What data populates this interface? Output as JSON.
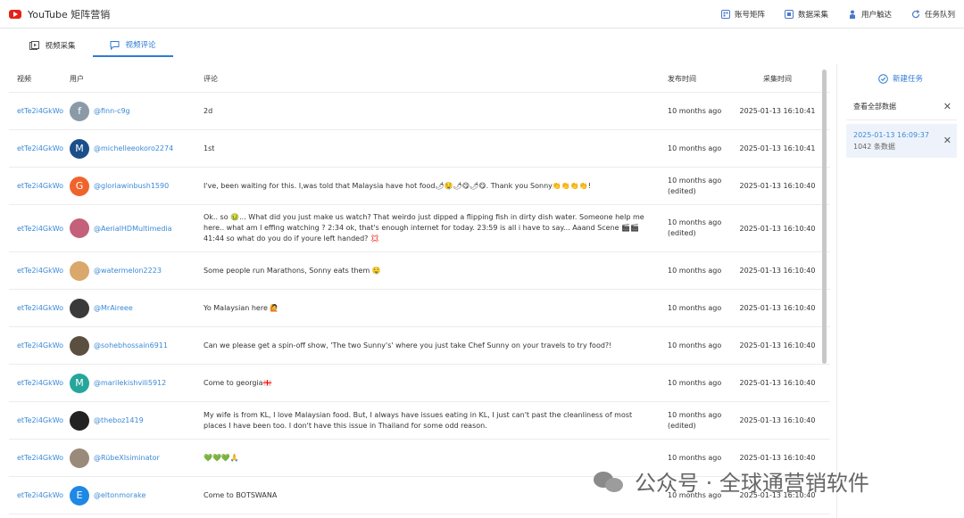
{
  "app": {
    "title": "YouTube 矩阵营销"
  },
  "top_actions": [
    {
      "label": "账号矩阵",
      "icon": "grid-icon"
    },
    {
      "label": "数据采集",
      "icon": "database-icon"
    },
    {
      "label": "用户触达",
      "icon": "user-reach-icon"
    },
    {
      "label": "任务队列",
      "icon": "refresh-icon"
    }
  ],
  "tabs": [
    {
      "label": "视频采集",
      "icon": "video-icon",
      "active": false
    },
    {
      "label": "视频评论",
      "icon": "comment-icon",
      "active": true
    }
  ],
  "table": {
    "headers": {
      "video": "视频",
      "user": "用户",
      "comment": "评论",
      "published": "发布时间",
      "collected": "采集时间"
    },
    "rows": [
      {
        "video": "etTe2i4GkWo",
        "avatar_letter": "f",
        "avatar_color": "#8a9aa6",
        "user": "@finn-c9g",
        "comment": "2d",
        "published": "10 months ago",
        "edited": "",
        "collected": "2025-01-13 16:10:41"
      },
      {
        "video": "etTe2i4GkWo",
        "avatar_letter": "M",
        "avatar_color": "#1b4f8a",
        "user": "@michelleeokoro2274",
        "comment": "1st",
        "published": "10 months ago",
        "edited": "",
        "collected": "2025-01-13 16:10:41"
      },
      {
        "video": "etTe2i4GkWo",
        "avatar_letter": "G",
        "avatar_color": "#f0642c",
        "user": "@gloriawinbush1590",
        "comment": "I've, been waiting for this. I,was told that Malaysia have hot food🌶🤤🌶😋🌶😋. Thank you Sonny👏👏👏👏!",
        "published": "10 months ago",
        "edited": "(edited)",
        "collected": "2025-01-13 16:10:40"
      },
      {
        "video": "etTe2i4GkWo",
        "avatar_letter": "",
        "avatar_color": "#c4607a",
        "user": "@AerialHDMultimedia",
        "comment": "Ok.. so 🤢... What did you just make us watch? That weirdo just dipped a flipping fish in dirty dish water. Someone help me here.. what am I effing watching ? 2:34 ok, that's enough internet for today. 23:59 is all i have to say... Aaand Scene 🎬🎬 41:44 so what do you do if youre left handed? 💢",
        "published": "10 months ago",
        "edited": "(edited)",
        "collected": "2025-01-13 16:10:40"
      },
      {
        "video": "etTe2i4GkWo",
        "avatar_letter": "",
        "avatar_color": "#d9a86a",
        "user": "@watermelon2223",
        "comment": "Some people run Marathons, Sonny eats them 🤤",
        "published": "10 months ago",
        "edited": "",
        "collected": "2025-01-13 16:10:40"
      },
      {
        "video": "etTe2i4GkWo",
        "avatar_letter": "",
        "avatar_color": "#3a3a3a",
        "user": "@MrAireee",
        "comment": "Yo Malaysian here 🙋",
        "published": "10 months ago",
        "edited": "",
        "collected": "2025-01-13 16:10:40"
      },
      {
        "video": "etTe2i4GkWo",
        "avatar_letter": "",
        "avatar_color": "#5b5040",
        "user": "@sohebhossain6911",
        "comment": "Can we please get a spin-off show, 'The two Sunny's' where you just take Chef Sunny on your travels to try food?!",
        "published": "10 months ago",
        "edited": "",
        "collected": "2025-01-13 16:10:40"
      },
      {
        "video": "etTe2i4GkWo",
        "avatar_letter": "M",
        "avatar_color": "#26a69a",
        "user": "@marilekishvili5912",
        "comment": "Come to georgia🇬🇪",
        "published": "10 months ago",
        "edited": "",
        "collected": "2025-01-13 16:10:40"
      },
      {
        "video": "etTe2i4GkWo",
        "avatar_letter": "",
        "avatar_color": "#222222",
        "user": "@theboz1419",
        "comment": "My wife is from KL, I love Malaysian food. But, I always have issues eating in KL, I just can't past the cleanliness of most places I have been too. I don't have this issue in Thailand for some odd reason.",
        "published": "10 months ago",
        "edited": "(edited)",
        "collected": "2025-01-13 16:10:40"
      },
      {
        "video": "etTe2i4GkWo",
        "avatar_letter": "",
        "avatar_color": "#9a8a7a",
        "user": "@RübeXIsiminator",
        "comment": "💚💚💚🙏",
        "published": "10 months ago",
        "edited": "",
        "collected": "2025-01-13 16:10:40"
      },
      {
        "video": "etTe2i4GkWo",
        "avatar_letter": "E",
        "avatar_color": "#1e88e5",
        "user": "@eltonmorake",
        "comment": "Come to BOTSWANA",
        "published": "10 months ago",
        "edited": "",
        "collected": "2025-01-13 16:10:40"
      }
    ]
  },
  "side": {
    "new_task_label": "新建任务",
    "view_all_label": "查看全部数据",
    "task": {
      "time": "2025-01-13 16:09:37",
      "count": "1042 条数据"
    }
  },
  "watermark": {
    "text": "公众号 · 全球通营销软件"
  }
}
